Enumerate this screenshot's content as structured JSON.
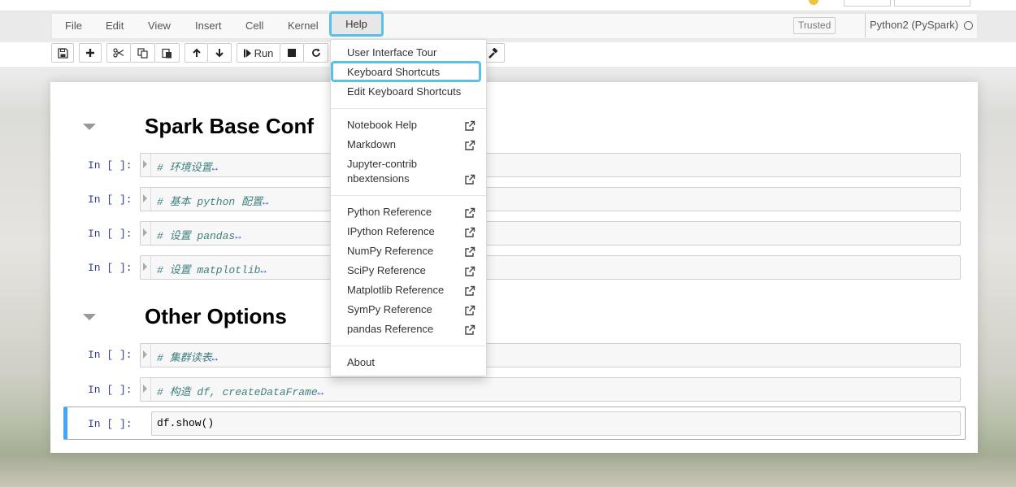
{
  "menubar": {
    "items": [
      "File",
      "Edit",
      "View",
      "Insert",
      "Cell",
      "Kernel",
      "Help"
    ],
    "trusted": "Trusted",
    "kernel": "Python2 (PySpark)"
  },
  "toolbar": {
    "run_label": "Run",
    "icons": [
      "save-icon",
      "plus-icon",
      "cut-icon",
      "copy-icon",
      "paste-icon",
      "arrow-up-icon",
      "arrow-down-icon",
      "step-forward-icon",
      "stop-icon",
      "restart-icon",
      "command-palette-icon"
    ]
  },
  "notebook": {
    "headings": [
      "Spark Base Conf",
      "Other Options"
    ],
    "cells": [
      {
        "prompt": "In [ ]:",
        "code": "# 环境设置",
        "folded": true
      },
      {
        "prompt": "In [ ]:",
        "code": "# 基本 python 配置",
        "folded": true
      },
      {
        "prompt": "In [ ]:",
        "code": "# 设置 pandas",
        "folded": true
      },
      {
        "prompt": "In [ ]:",
        "code": "# 设置 matplotlib",
        "folded": true
      },
      {
        "prompt": "In [ ]:",
        "code": "# 集群读表",
        "folded": true
      },
      {
        "prompt": "In [ ]:",
        "code": "# 构造 df, createDataFrame",
        "folded": true
      },
      {
        "prompt": "In [ ]:",
        "code": "df.show()",
        "folded": false
      }
    ],
    "fold_marker": "↔"
  },
  "help_menu": {
    "group1": [
      "User Interface Tour",
      "Keyboard Shortcuts",
      "Edit Keyboard Shortcuts"
    ],
    "group2": [
      "Notebook Help",
      "Markdown",
      "Jupyter-contrib",
      "nbextensions"
    ],
    "group3": [
      "Python Reference",
      "IPython Reference",
      "NumPy Reference",
      "SciPy Reference",
      "Matplotlib Reference",
      "SymPy Reference",
      "pandas Reference"
    ],
    "group4": [
      "About"
    ]
  },
  "colors": {
    "highlight": "#5bc0e4",
    "prompt": "#303f9f",
    "comment": "#408080",
    "selected_cell_bar": "#42a5f5"
  }
}
